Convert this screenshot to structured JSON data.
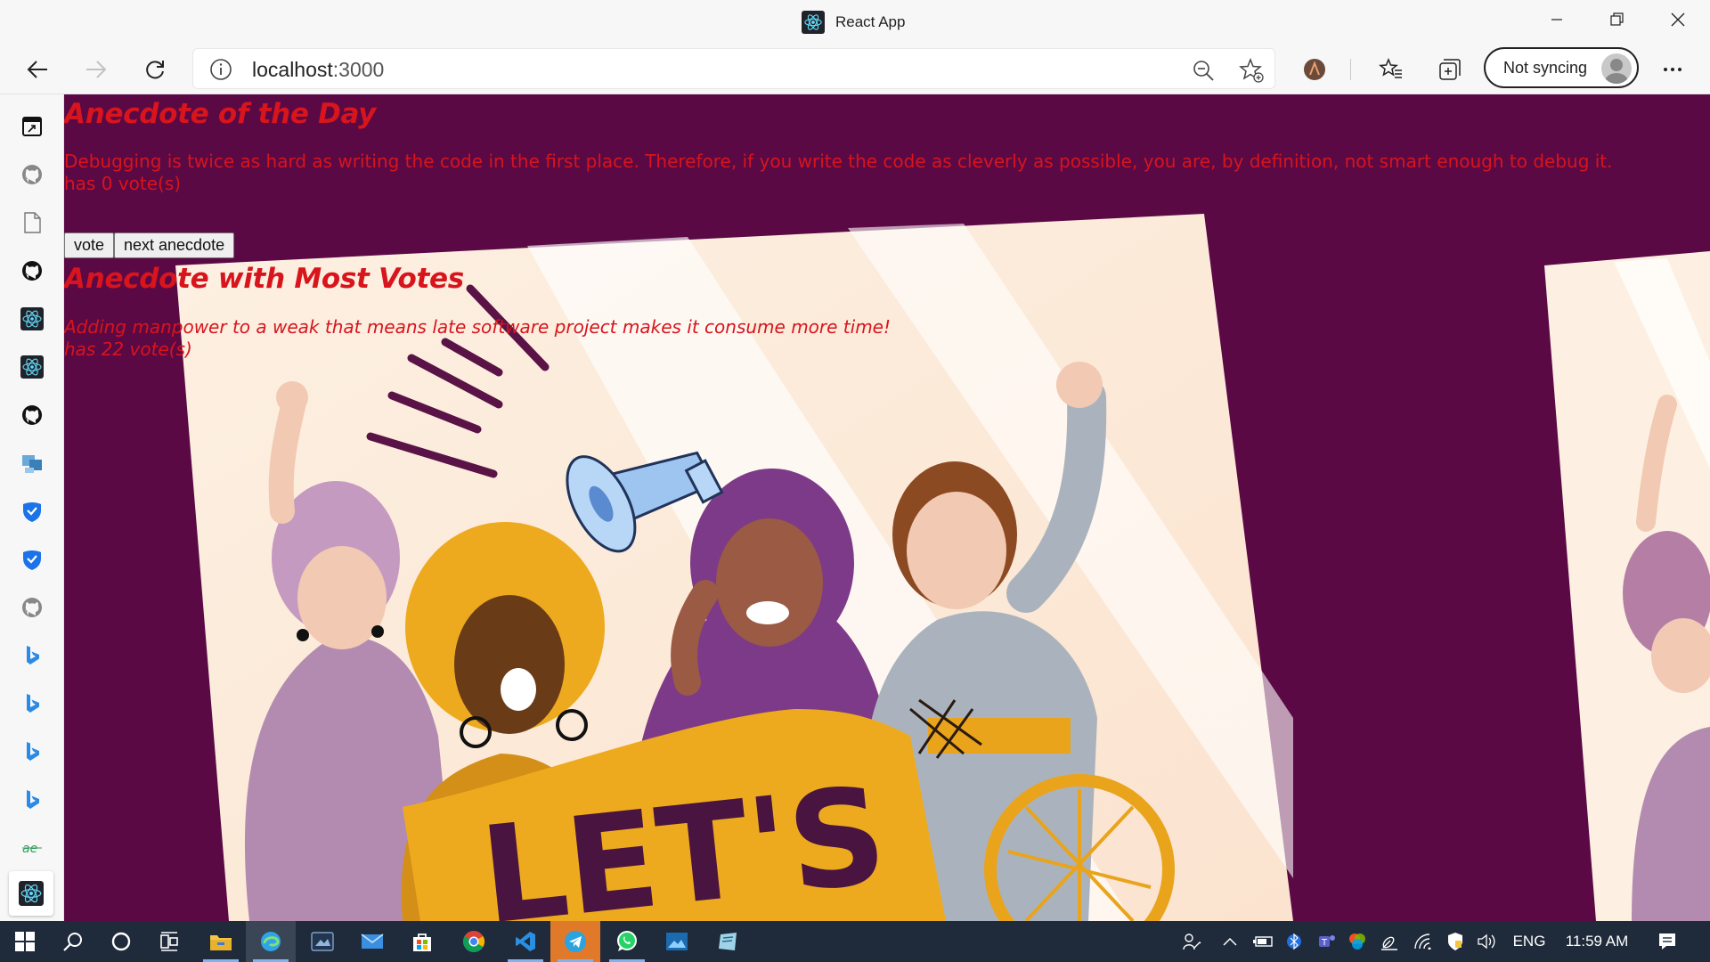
{
  "window": {
    "title": "React App",
    "controls": {
      "minimize_icon": "minimize-icon",
      "restore_icon": "restore-icon",
      "close_icon": "close-icon"
    }
  },
  "navbar": {
    "url_host": "localhost",
    "url_port": ":3000",
    "sync_label": "Not syncing"
  },
  "rail": {
    "items": [
      "app-icon",
      "github-icon",
      "file-icon",
      "github-icon",
      "react-icon",
      "react-icon",
      "github-icon",
      "web-icon",
      "shield-icon",
      "shield-icon",
      "github-icon",
      "bing-icon",
      "bing-icon",
      "bing-icon",
      "bing-icon",
      "ae-icon",
      "react-icon"
    ]
  },
  "page": {
    "heading_day": "Anecdote of the Day",
    "anecdote_day": "Debugging is twice as hard as writing the code in the first place. Therefore, if you write the code as cleverly as possible, you are, by definition, not smart enough to debug it.",
    "votes_day": "has 0 vote(s)",
    "vote_button": "vote",
    "next_button": "next anecdote",
    "heading_most": "Anecdote with Most Votes",
    "anecdote_most": "Adding manpower to a weak that means late software project makes it consume more time!",
    "votes_most": "has 22 vote(s)",
    "illustration_banner": "LET'S",
    "colors": {
      "background": "#5a0945",
      "text": "#d8141c"
    }
  },
  "taskbar": {
    "language": "ENG",
    "time": "11:59 AM"
  }
}
